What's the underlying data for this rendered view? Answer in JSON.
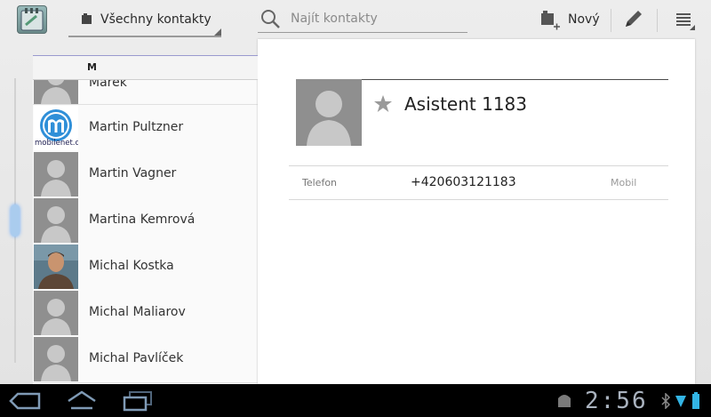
{
  "topbar": {
    "filter_label": "Všechny kontakty",
    "search_placeholder": "Najít kontakty",
    "new_label": "Nový"
  },
  "list": {
    "section_letter": "M",
    "contacts": [
      {
        "name": "Marek",
        "photo": "default-avatar"
      },
      {
        "name": "Martin Pultzner",
        "photo": "mobilenet-logo",
        "photo_caption": "mobilenet.cz"
      },
      {
        "name": "Martin Vagner",
        "photo": "default-avatar"
      },
      {
        "name": "Martina Kemrová",
        "photo": "default-avatar"
      },
      {
        "name": "Michal Kostka",
        "photo": "person-photo"
      },
      {
        "name": "Michal Maliarov",
        "photo": "default-avatar"
      },
      {
        "name": "Michal Pavlíček",
        "photo": "default-avatar"
      }
    ]
  },
  "detail": {
    "contact_name": "Asistent 1183",
    "phone_label": "Telefon",
    "phone_number": "+420603121183",
    "phone_type": "Mobil"
  },
  "sysbar": {
    "clock": "2:56"
  },
  "colors": {
    "accent_blue": "#33b5e5",
    "avatar_bg": "#8f8f8f"
  }
}
